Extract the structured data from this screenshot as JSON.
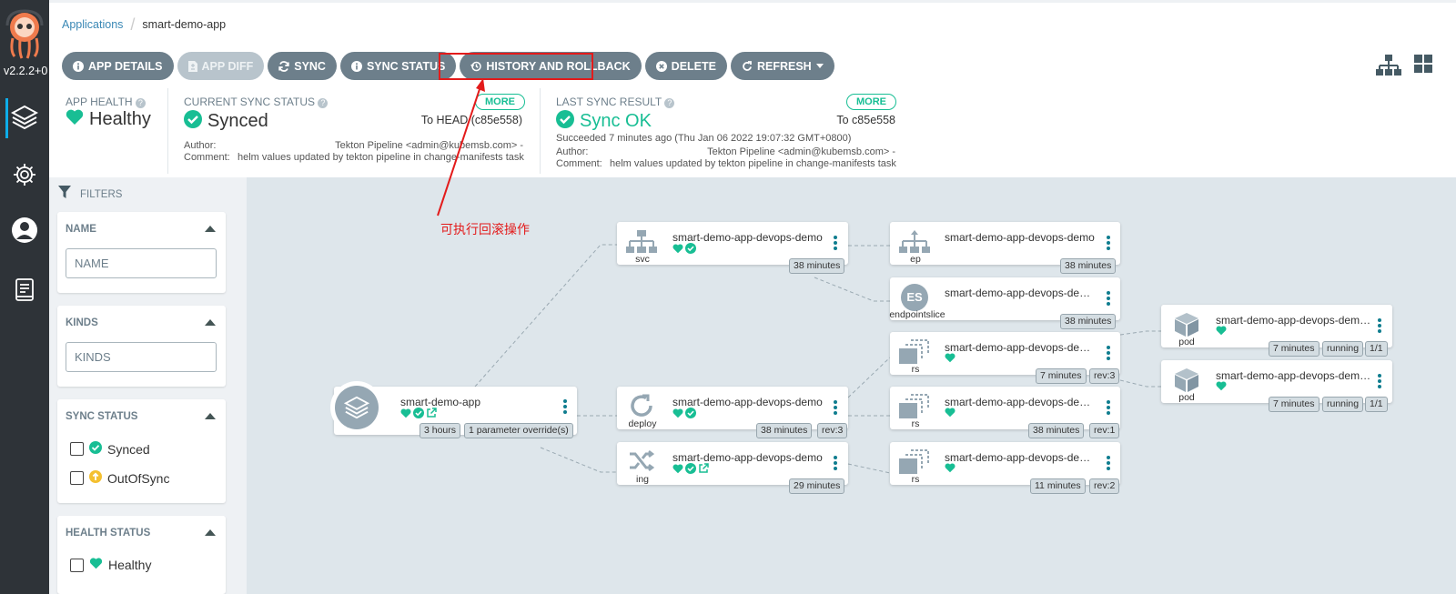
{
  "nav": {
    "version": "v2.2.2+0"
  },
  "breadcrumb": {
    "root": "Applications",
    "current": "smart-demo-app"
  },
  "toolbar": {
    "app_details": "APP DETAILS",
    "app_diff": "APP DIFF",
    "sync": "SYNC",
    "sync_status": "SYNC STATUS",
    "history": "HISTORY AND ROLLBACK",
    "delete": "DELETE",
    "refresh": "REFRESH"
  },
  "status": {
    "health": {
      "label": "APP HEALTH",
      "value": "Healthy"
    },
    "current_sync": {
      "label": "CURRENT SYNC STATUS",
      "value": "Synced",
      "more": "MORE",
      "to": "To HEAD (c85e558)",
      "author_label": "Author:",
      "author": "Tekton Pipeline <admin@kubemsb.com> -",
      "comment_label": "Comment:",
      "comment": "helm values updated by tekton pipeline in change-manifests task"
    },
    "last_sync": {
      "label": "LAST SYNC RESULT",
      "value": "Sync OK",
      "more": "MORE",
      "to": "To c85e558",
      "succeeded": "Succeeded 7 minutes ago (Thu Jan 06 2022 19:07:32 GMT+0800)",
      "author_label": "Author:",
      "author": "Tekton Pipeline <admin@kubemsb.com> -",
      "comment_label": "Comment:",
      "comment": "helm values updated by tekton pipeline in change-manifests task"
    }
  },
  "filters": {
    "title": "FILTERS",
    "name": {
      "title": "NAME",
      "placeholder": "NAME"
    },
    "kinds": {
      "title": "KINDS",
      "placeholder": "KINDS"
    },
    "sync_status": {
      "title": "SYNC STATUS",
      "synced": "Synced",
      "out_of_sync": "OutOfSync"
    },
    "health_status": {
      "title": "HEALTH STATUS",
      "healthy": "Healthy"
    }
  },
  "annotation": "可执行回滚操作",
  "colors": {
    "accent": "#18be94",
    "nav_bg": "#2e3338",
    "button": "#6d7f8b",
    "highlight": "#e31b1b",
    "canvas": "#dee6eb",
    "out_of_sync": "#f4c030"
  },
  "graph": {
    "app": {
      "name": "smart-demo-app",
      "tags": [
        "3 hours",
        "1 parameter override(s)"
      ]
    },
    "svc": {
      "name": "smart-demo-app-devops-demo",
      "kind": "svc",
      "tags": [
        "38 minutes"
      ]
    },
    "deploy": {
      "name": "smart-demo-app-devops-demo",
      "kind": "deploy",
      "tags": [
        "38 minutes",
        "rev:3"
      ]
    },
    "ing": {
      "name": "smart-demo-app-devops-demo",
      "kind": "ing",
      "tags": [
        "29 minutes"
      ]
    },
    "ep": {
      "name": "smart-demo-app-devops-demo",
      "kind": "ep",
      "tags": [
        "38 minutes"
      ]
    },
    "eps": {
      "name": "smart-demo-app-devops-demo...",
      "kind": "endpointslice",
      "icon": "ES",
      "tags": [
        "38 minutes"
      ]
    },
    "rs3": {
      "name": "smart-demo-app-devops-demo...",
      "kind": "rs",
      "tags": [
        "7 minutes",
        "rev:3"
      ]
    },
    "rs1": {
      "name": "smart-demo-app-devops-demo...",
      "kind": "rs",
      "tags": [
        "38 minutes",
        "rev:1"
      ]
    },
    "rs2": {
      "name": "smart-demo-app-devops-demo...",
      "kind": "rs",
      "tags": [
        "11 minutes",
        "rev:2"
      ]
    },
    "pod1": {
      "name": "smart-demo-app-devops-demo...",
      "kind": "pod",
      "tags": [
        "7 minutes",
        "running",
        "1/1"
      ]
    },
    "pod2": {
      "name": "smart-demo-app-devops-demo...",
      "kind": "pod",
      "tags": [
        "7 minutes",
        "running",
        "1/1"
      ]
    }
  }
}
